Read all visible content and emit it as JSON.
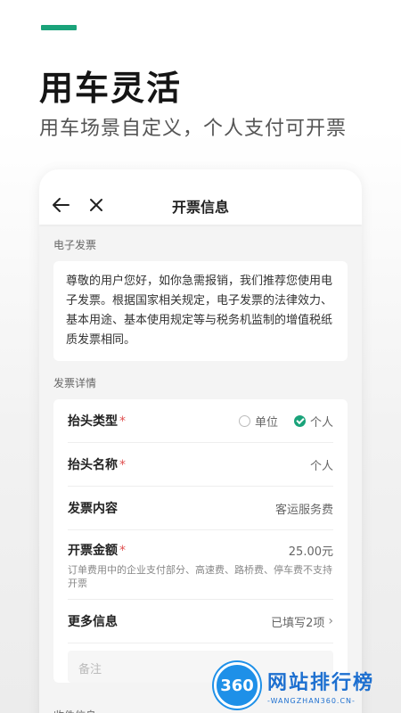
{
  "hero": {
    "title": "用车灵活",
    "subtitle": "用车场景自定义，个人支付可开票"
  },
  "nav": {
    "title": "开票信息"
  },
  "electronic": {
    "section_label": "电子发票",
    "notice": "尊敬的用户您好，如你急需报销，我们推荐您使用电子发票。根据国家相关规定，电子发票的法律效力、基本用途、基本使用规定等与税务机监制的增值税纸质发票相同。"
  },
  "details": {
    "section_label": "发票详情",
    "header_type": {
      "label": "抬头类型",
      "required_mark": "*",
      "options": [
        "单位",
        "个人"
      ],
      "selected": "个人"
    },
    "header_name": {
      "label": "抬头名称",
      "required_mark": "*",
      "value": "个人"
    },
    "content": {
      "label": "发票内容",
      "value": "客运服务费"
    },
    "amount": {
      "label": "开票金额",
      "required_mark": "*",
      "value": "25.00元",
      "hint": "订单费用中的企业支付部分、高速费、路桥费、停车费不支持开票"
    },
    "more": {
      "label": "更多信息",
      "value": "已填写2项"
    },
    "remark_placeholder": "备注"
  },
  "shipping": {
    "section_label": "收件信息"
  },
  "watermark": {
    "logo_text": "360",
    "name": "网站排行榜",
    "url": "-WANGZHAN360.CN-"
  },
  "colors": {
    "accent": "#1aa37a",
    "required": "#e05050",
    "watermark_blue": "#1e90e8"
  }
}
